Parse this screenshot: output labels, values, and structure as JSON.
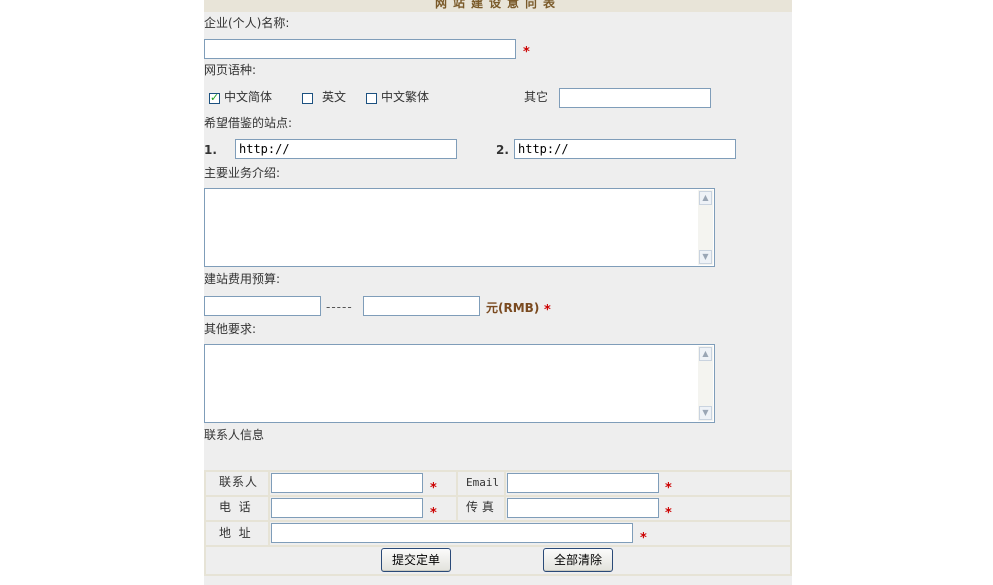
{
  "form": {
    "title": "网站建设意向表",
    "company_name_label": "企业(个人)名称:",
    "required_mark": "*",
    "language_label": "网页语种:",
    "languages": [
      {
        "label": "中文简体",
        "checked": true
      },
      {
        "label": "英文",
        "checked": false
      },
      {
        "label": "中文繁体",
        "checked": false
      }
    ],
    "other_label": "其它",
    "reference_sites_label": "希望借鉴的站点:",
    "site1_number": "1.",
    "site1_value": "http://",
    "site2_number": "2.",
    "site2_value": "http://",
    "business_label": "主要业务介绍:",
    "budget_label": "建站费用预算:",
    "budget_separator": "-----",
    "budget_unit": "元(RMB)",
    "other_requirements_label": "其他要求:",
    "contact_section_label": "联系人信息"
  },
  "contact": {
    "person_label": "联系人",
    "email_label": "Email",
    "phone_label": "电  话",
    "fax_label": "传 真",
    "address_label": "地  址"
  },
  "buttons": {
    "submit_label": "提交定单",
    "clear_label": "全部清除"
  },
  "colors": {
    "panel_bg": "#eeeeee",
    "required": "#cc0000",
    "input_border": "#7f9db9",
    "button_border": "#2a4a78"
  }
}
